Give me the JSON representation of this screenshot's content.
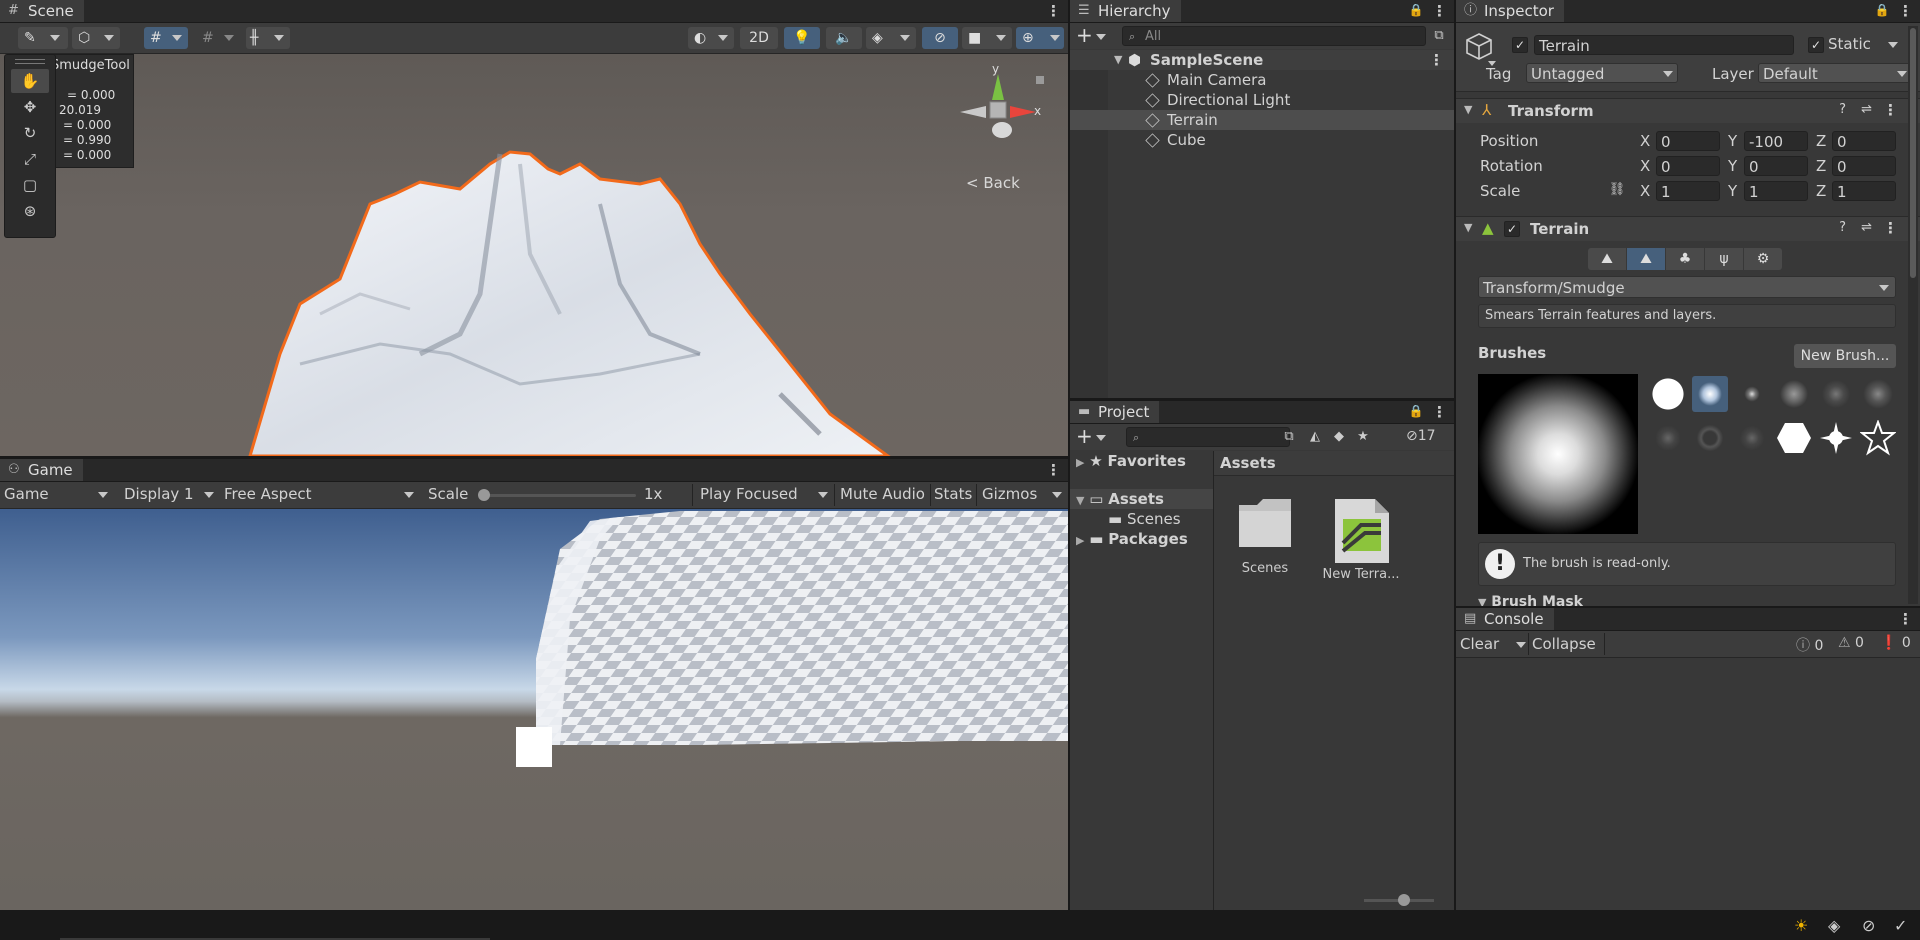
{
  "scene": {
    "tab_label": "Scene",
    "toolbar": {
      "mode_2d": "2D"
    },
    "back_label": "Back",
    "gizmo_y": "y",
    "gizmo_x": "x",
    "overlay": {
      "title": "SmudgeTool",
      "values": [
        "= 0.000",
        "20.019",
        "= 0.000",
        "= 0.990",
        "= 0.000"
      ]
    }
  },
  "game": {
    "tab_label": "Game",
    "toolbar": {
      "view_select": "Game",
      "display": "Display 1",
      "aspect": "Free Aspect",
      "scale_label": "Scale",
      "scale_value": "1x",
      "play_mode": "Play Focused",
      "mute_audio": "Mute Audio",
      "stats": "Stats",
      "gizmos": "Gizmos"
    }
  },
  "hierarchy": {
    "tab_label": "Hierarchy",
    "search_placeholder": "All",
    "scene_name": "SampleScene",
    "items": [
      "Main Camera",
      "Directional Light",
      "Terrain",
      "Cube"
    ],
    "selected": "Terrain"
  },
  "project": {
    "tab_label": "Project",
    "hidden_count": "17",
    "tree": {
      "favorites": "Favorites",
      "assets": "Assets",
      "scenes": "Scenes",
      "packages": "Packages"
    },
    "breadcrumb": "Assets",
    "files": [
      {
        "name": "Scenes",
        "type": "folder"
      },
      {
        "name": "New Terra...",
        "type": "terrain"
      }
    ]
  },
  "inspector": {
    "tab_label": "Inspector",
    "object_name": "Terrain",
    "static_label": "Static",
    "tag_label": "Tag",
    "tag_value": "Untagged",
    "layer_label": "Layer",
    "layer_value": "Default",
    "transform": {
      "title": "Transform",
      "position_label": "Position",
      "rotation_label": "Rotation",
      "scale_label": "Scale",
      "position": {
        "x": "0",
        "y": "-100",
        "z": "0"
      },
      "rotation": {
        "x": "0",
        "y": "0",
        "z": "0"
      },
      "scale": {
        "x": "1",
        "y": "1",
        "z": "1"
      },
      "axis_x": "X",
      "axis_y": "Y",
      "axis_z": "Z"
    },
    "terrain": {
      "title": "Terrain",
      "tool_select": "Transform/Smudge",
      "description": "Smears Terrain features and layers.",
      "brushes_label": "Brushes",
      "new_brush_button": "New Brush...",
      "readonly_message": "The brush is read-only.",
      "brush_mask_label": "Brush Mask"
    }
  },
  "console": {
    "tab_label": "Console",
    "clear": "Clear",
    "collapse": "Collapse",
    "info_count": "0",
    "warn_count": "0",
    "error_count": "0"
  },
  "colors": {
    "selection_outline": "#f26a1b",
    "active_button": "#46607c",
    "terrain_icon_green": "#8cc43c"
  }
}
